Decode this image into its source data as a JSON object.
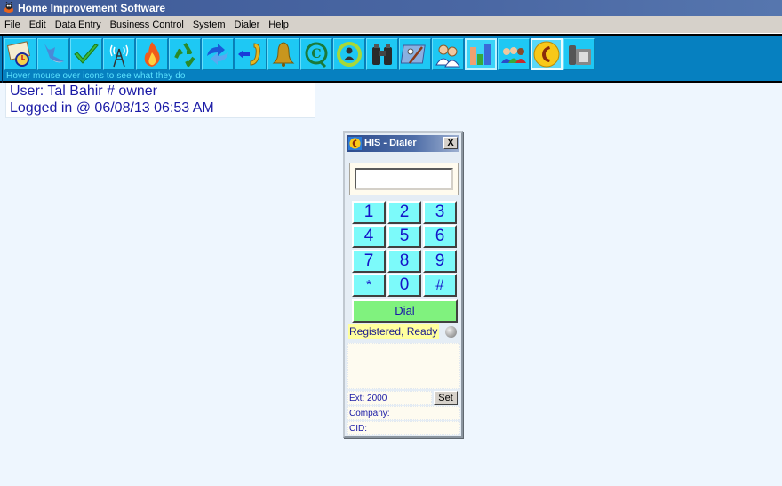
{
  "window": {
    "title": "Home Improvement Software",
    "app_icon": "bug-mascot-icon"
  },
  "menu": {
    "items": [
      "File",
      "Edit",
      "Data Entry",
      "Business Control",
      "System",
      "Dialer",
      "Help"
    ]
  },
  "toolbar": {
    "hint": "Hover mouse over icons to see what they do",
    "buttons": [
      {
        "icon": "calendar-book-clock-icon"
      },
      {
        "icon": "fish-icon"
      },
      {
        "icon": "checkmark-icon"
      },
      {
        "icon": "antenna-tower-icon"
      },
      {
        "icon": "flame-icon"
      },
      {
        "icon": "recycle-icon"
      },
      {
        "icon": "refresh-arrows-icon"
      },
      {
        "icon": "phone-return-icon"
      },
      {
        "icon": "bell-icon"
      },
      {
        "icon": "copyright-q-icon"
      },
      {
        "icon": "user-target-icon"
      },
      {
        "icon": "binoculars-icon"
      },
      {
        "icon": "tools-folder-icon"
      },
      {
        "icon": "two-users-icon"
      },
      {
        "icon": "bar-chart-icon",
        "state": "active"
      },
      {
        "icon": "group-users-icon"
      },
      {
        "icon": "phone-circle-icon",
        "state": "pressed"
      },
      {
        "icon": "desk-phone-icon"
      }
    ]
  },
  "user_info": {
    "user_line": "User: Tal Bahir # owner",
    "login_line": "Logged in @ 06/08/13 06:53 AM"
  },
  "dialer": {
    "title": "HIS - Dialer",
    "close_label": "X",
    "number_value": "",
    "keys": [
      "1",
      "2",
      "3",
      "4",
      "5",
      "6",
      "7",
      "8",
      "9",
      "*",
      "0",
      "#"
    ],
    "dial_label": "Dial",
    "status": "Registered, Ready",
    "ext_label": "Ext: 2000",
    "set_label": "Set",
    "company_label": "Company:",
    "cid_label": "CID:"
  }
}
